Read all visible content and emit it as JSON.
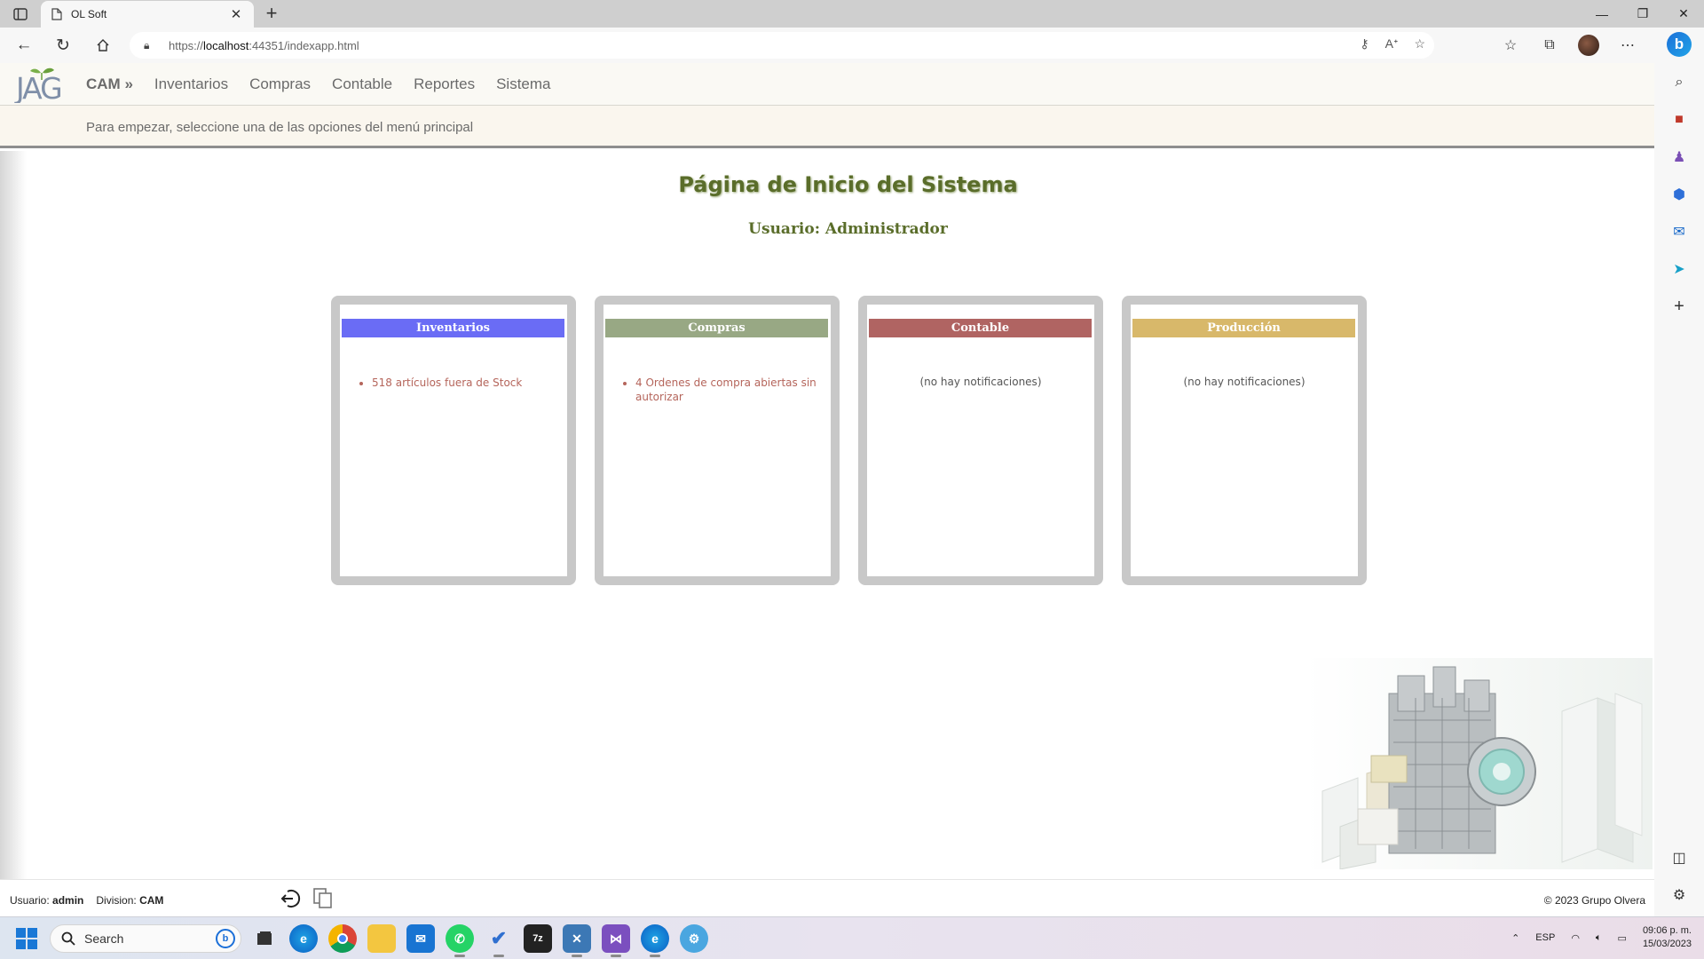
{
  "browser": {
    "tab_title": "OL Soft",
    "url_protocol": "https://",
    "url_host": "localhost",
    "url_path": ":44351/indexapp.html"
  },
  "app": {
    "menu": {
      "brand": "CAM »",
      "items": [
        "Inventarios",
        "Compras",
        "Contable",
        "Reportes",
        "Sistema"
      ]
    },
    "subheader_text": "Para empezar, seleccione una de las opciones del menú principal",
    "page_title": "Página de Inicio del Sistema",
    "page_user": "Usuario: Administrador",
    "cards": [
      {
        "title": "Inventarios",
        "color": "#6a6cf5",
        "items": [
          "518 artículos fuera de Stock"
        ],
        "empty": ""
      },
      {
        "title": "Compras",
        "color": "#98a884",
        "items": [
          "4 Ordenes de compra abiertas sin autorizar"
        ],
        "empty": ""
      },
      {
        "title": "Contable",
        "color": "#b06462",
        "items": [],
        "empty": "(no hay notificaciones)"
      },
      {
        "title": "Producción",
        "color": "#d8b86a",
        "items": [],
        "empty": "(no hay notificaciones)"
      }
    ],
    "status": {
      "user_label": "Usuario:",
      "user_value": "admin",
      "division_label": "Division:",
      "division_value": "CAM",
      "copyright": "© 2023 Grupo Olvera"
    }
  },
  "taskbar": {
    "search_placeholder": "Search",
    "language": "ESP",
    "time": "09:06 p. m.",
    "date": "15/03/2023"
  },
  "icons": {
    "logo": "jag-logo",
    "logout": "logout-icon",
    "copy": "copy-icon"
  }
}
